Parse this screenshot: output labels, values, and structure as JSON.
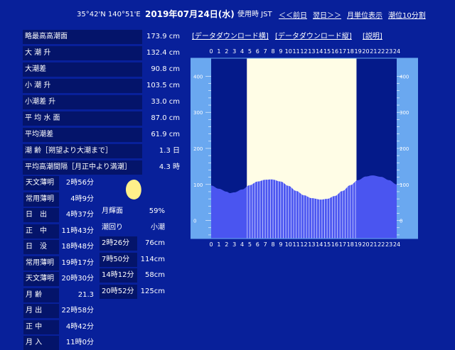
{
  "header": {
    "coords": "35°42'N 140°51'E",
    "date": "2019年07月24日(水)",
    "tz": "使用時 JST",
    "prev": "＜＜前日",
    "next": "翌日＞＞",
    "moon_unit": "月単位表示",
    "interval": "潮位10分割"
  },
  "stats": [
    {
      "label": "略最高高潮面",
      "value": "173.9 cm"
    },
    {
      "label": "大 潮 升",
      "value": "132.4 cm"
    },
    {
      "label": "大潮差",
      "value": "90.8 cm"
    },
    {
      "label": "小 潮 升",
      "value": "103.5 cm"
    },
    {
      "label": "小潮差 升",
      "value": "33.0 cm"
    },
    {
      "label": "平 均 水 面",
      "value": "87.0 cm"
    },
    {
      "label": "平均潮差",
      "value": "61.9 cm"
    },
    {
      "label": "潮 齢［朔望より大潮まで］",
      "value": "1.3 日"
    },
    {
      "label": "平均高潮間隔［月正中より満潮］",
      "value": "4.3 時"
    }
  ],
  "sun": [
    {
      "label": "天文薄明",
      "value": "2時56分"
    },
    {
      "label": "常用薄明",
      "value": "4時9分"
    },
    {
      "label": "日　出",
      "value": "4時37分"
    },
    {
      "label": "正　中",
      "value": "11時43分"
    },
    {
      "label": "日　没",
      "value": "18時48分"
    },
    {
      "label": "常用薄明",
      "value": "19時17分"
    },
    {
      "label": "天文薄明",
      "value": "20時30分"
    },
    {
      "label": "月 齢",
      "value": "21.3"
    },
    {
      "label": "月 出",
      "value": "22時58分"
    },
    {
      "label": "正 中",
      "value": "4時42分"
    },
    {
      "label": "月 入",
      "value": "11時0分"
    }
  ],
  "moon_info": [
    {
      "label": "月輝面",
      "value": "59%"
    },
    {
      "label": "潮回り",
      "value": "小潮"
    }
  ],
  "tides": [
    {
      "time": "2時26分",
      "value": "76cm"
    },
    {
      "time": "7時50分",
      "value": "114cm"
    },
    {
      "time": "14時12分",
      "value": "58cm"
    },
    {
      "time": "20時52分",
      "value": "125cm"
    }
  ],
  "downloads": {
    "horizontal": "[データダウンロード横]",
    "vertical": "[データダウンロード縦]",
    "explain": "[説明]"
  },
  "chart_data": {
    "type": "area",
    "x_ticks": [
      "0",
      "1",
      "2",
      "3",
      "4",
      "5",
      "6",
      "7",
      "8",
      "9",
      "10",
      "11",
      "12",
      "13",
      "14",
      "15",
      "16",
      "17",
      "18",
      "19",
      "20",
      "21",
      "22",
      "23",
      "24"
    ],
    "y_ticks": [
      "400",
      "300",
      "200",
      "100",
      "0"
    ],
    "ylim": [
      -50,
      450
    ],
    "xlim": [
      0,
      24
    ],
    "daylight": [
      4.62,
      18.8
    ],
    "series": [
      {
        "x": [
          0,
          1,
          2,
          2.43,
          3,
          4,
          5,
          6,
          7,
          7.83,
          9,
          10,
          11,
          12,
          13,
          14.2,
          15,
          16,
          17,
          18,
          19,
          20,
          20.87,
          22,
          23,
          24
        ],
        "y": [
          97,
          88,
          80,
          76,
          78,
          86,
          98,
          108,
          113,
          114,
          108,
          96,
          82,
          70,
          62,
          58,
          60,
          68,
          82,
          98,
          112,
          122,
          125,
          121,
          112,
          100
        ]
      }
    ],
    "colors": {
      "fill": "#4a55f0",
      "bar": "#c8ccff",
      "day": "#fffde6",
      "scale": "#6aa8f0"
    }
  }
}
